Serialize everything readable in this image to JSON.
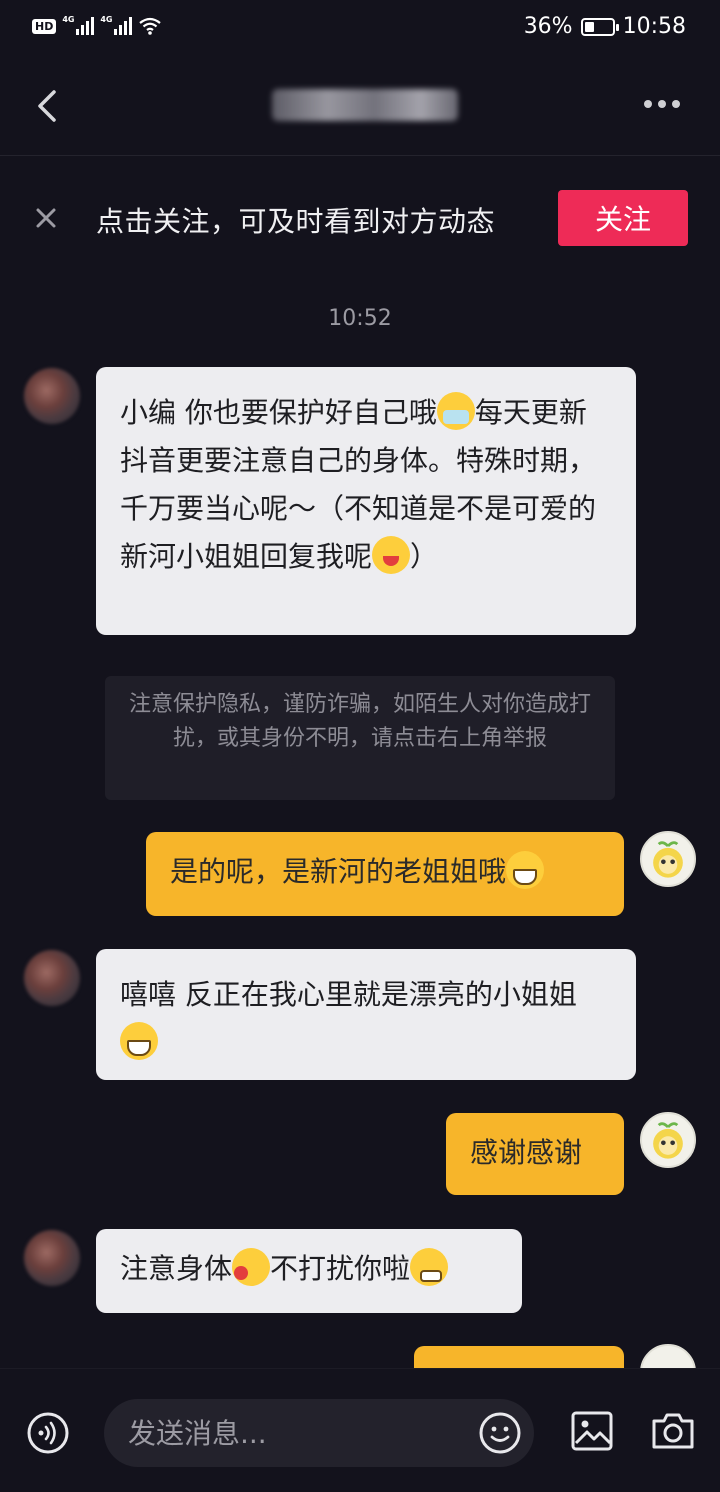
{
  "status_bar": {
    "left_badge": "HD",
    "signal_1": "4G",
    "signal_2": "4G",
    "battery": "36%",
    "battery_level": 0.36,
    "time": "10:58"
  },
  "header": {
    "title": "",
    "icons": [
      "back-icon",
      "more-icon"
    ]
  },
  "follow_banner": {
    "text": "点击关注，可及时看到对方动态",
    "button_label": "关注",
    "button_color": "#ee2b57"
  },
  "timestamp": "10:52",
  "messages": [
    {
      "sender": "them",
      "text": "小编 你也要保护好自己哦",
      "emoji1": "mask-face-emoji",
      "text2": "每天更新抖音更要注意自己的身体。特殊时期，千万要当心呢～（不知道是不是可爱的新河小姐姐回复我呢",
      "emoji2": "wink-tongue-emoji",
      "text3": "）"
    },
    {
      "sender": "me",
      "text": "是的呢，是新河的老姐姐哦",
      "emoji": "grin-emoji"
    },
    {
      "sender": "them",
      "text": "嘻嘻 反正在我心里就是漂亮的小姐姐",
      "emoji": "grin-emoji"
    },
    {
      "sender": "me",
      "text": "感谢感谢"
    },
    {
      "sender": "them",
      "text": "注意身体",
      "emoji1": "kiss-emoji",
      "text2": "不打扰你啦",
      "emoji2": "silly-emoji"
    }
  ],
  "privacy_notice": "注意保护隐私，谨防诈骗，如陌生人对你造成打扰，或其身份不明，请点击右上角举报",
  "input_bar": {
    "placeholder": "发送消息..."
  },
  "colors": {
    "background": "#13121c",
    "incoming_bubble": "#ededf0",
    "outgoing_bubble": "#f7b52a"
  }
}
